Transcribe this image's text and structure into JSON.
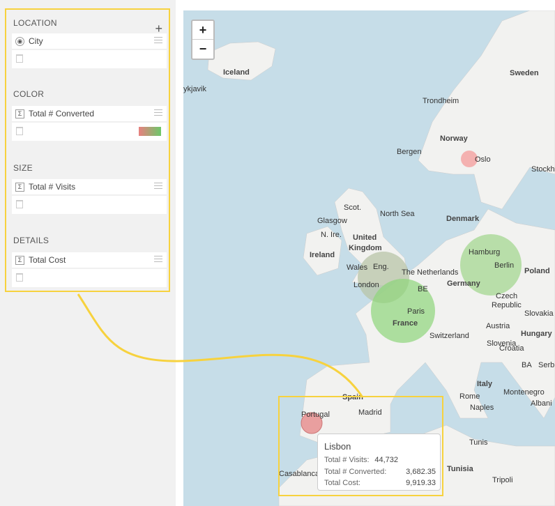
{
  "sections": [
    {
      "title": "LOCATION",
      "field": "City",
      "glyph": "globe"
    },
    {
      "title": "COLOR",
      "field": "Total # Converted",
      "glyph": "Σ"
    },
    {
      "title": "SIZE",
      "field": "Total # Visits",
      "glyph": "Σ"
    },
    {
      "title": "DETAILS",
      "field": "Total Cost",
      "glyph": "Σ"
    }
  ],
  "color_scale": {
    "low": "#e8807f",
    "high": "#6cc86a"
  },
  "zoom": {
    "in": "+",
    "out": "−"
  },
  "labels": {
    "iceland": "Iceland",
    "reykjavik": "ykjavik",
    "sweden": "Sweden",
    "trondheim": "Trondheim",
    "norway": "Norway",
    "bergen": "Bergen",
    "oslo": "Oslo",
    "stockholm": "Stockh",
    "scot": "Scot.",
    "glasgow": "Glasgow",
    "north_sea": "North Sea",
    "denmark": "Denmark",
    "uk": "United",
    "uk2": "Kingdom",
    "nire": "N. Ire.",
    "ireland": "Ireland",
    "hamburg": "Hamburg",
    "berlin": "Berlin",
    "poland": "Poland",
    "wales": "Wales",
    "eng": "Eng.",
    "netherlands": "The Netherlands",
    "london": "London",
    "germany": "Germany",
    "be": "BE",
    "czech": "Czech",
    "republic": "Republic",
    "paris": "Paris",
    "slovakia": "Slovakia",
    "france": "France",
    "austria": "Austria",
    "hungary": "Hungary",
    "switzerland": "Switzerland",
    "slovenia": "Slovenia",
    "croatia": "Croatia",
    "ba": "BA",
    "serbia": "Serbia",
    "italy": "Italy",
    "montenegro": "Montenegro",
    "rome": "Rome",
    "albania": "Albani",
    "spain": "Spain",
    "naples": "Naples",
    "portugal": "Portugal",
    "madrid": "Madrid",
    "tunis": "Tunis",
    "casablanca": "Casablanca",
    "tunisia": "Tunisia",
    "tripoli": "Tripoli"
  },
  "cities": [
    {
      "name": "Oslo",
      "color": "#f4a0a0"
    },
    {
      "name": "London",
      "color": "#b8c4a8"
    },
    {
      "name": "Paris",
      "color": "#8ed67a"
    },
    {
      "name": "Berlin",
      "color": "#9fd68a"
    },
    {
      "name": "Lisbon",
      "color": "#e89090"
    }
  ],
  "tooltip": {
    "city": "Lisbon",
    "rows": [
      {
        "label": "Total # Visits:",
        "value": "44,732"
      },
      {
        "label": "Total # Converted:",
        "value": "3,682.35"
      },
      {
        "label": "Total Cost:",
        "value": "9,919.33"
      }
    ]
  }
}
